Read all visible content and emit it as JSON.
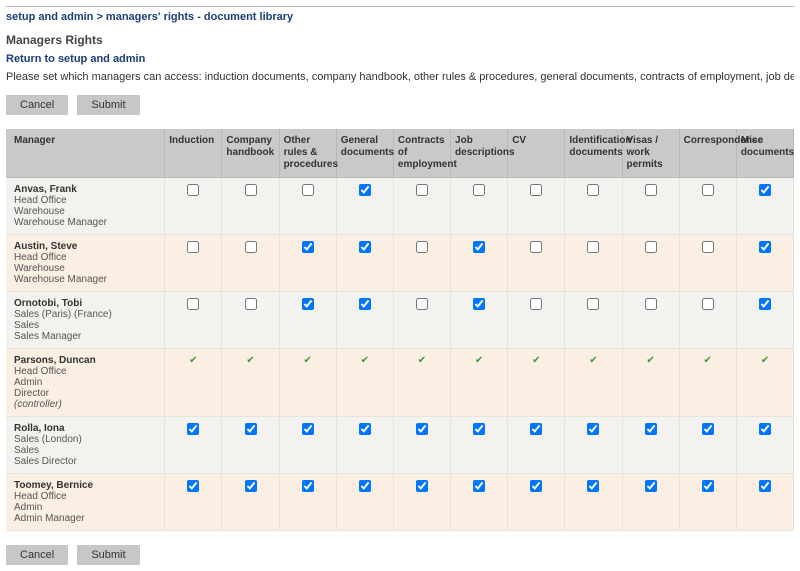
{
  "breadcrumb": "setup and admin > managers' rights - document library",
  "page_title": "Managers Rights",
  "return_link": "Return to setup and admin",
  "intro_text": "Please set which managers can access: induction documents, company handbook, other rules & procedures, general documents, contracts of employment, job descriptions, CVs, appraisals, correspondence...",
  "buttons": {
    "cancel": "Cancel",
    "submit": "Submit"
  },
  "columns": [
    "Manager",
    "Induction",
    "Company handbook",
    "Other rules & procedures",
    "General documents",
    "Contracts of employment",
    "Job descriptions",
    "CV",
    "Identification documents",
    "Visas / work permits",
    "Correspondence",
    "Misc documents"
  ],
  "rows": [
    {
      "name": "Anvas, Frank",
      "lines": [
        "Head Office",
        "Warehouse",
        "Warehouse Manager"
      ],
      "locked": false,
      "values": [
        false,
        false,
        false,
        true,
        false,
        false,
        false,
        false,
        false,
        false,
        true
      ]
    },
    {
      "name": "Austin, Steve",
      "lines": [
        "Head Office",
        "Warehouse",
        "Warehouse Manager"
      ],
      "locked": false,
      "values": [
        false,
        false,
        true,
        true,
        false,
        true,
        false,
        false,
        false,
        false,
        true
      ]
    },
    {
      "name": "Ornotobi, Tobi",
      "lines": [
        "Sales (Paris) (France)",
        "Sales",
        "Sales Manager"
      ],
      "locked": false,
      "values": [
        false,
        false,
        true,
        true,
        false,
        true,
        false,
        false,
        false,
        false,
        true
      ]
    },
    {
      "name": "Parsons, Duncan",
      "lines": [
        "Head Office",
        "Admin",
        "Director",
        "(controller)"
      ],
      "italic_last": true,
      "locked": true,
      "values": [
        true,
        true,
        true,
        true,
        true,
        true,
        true,
        true,
        true,
        true,
        true
      ]
    },
    {
      "name": "Rolla, Iona",
      "lines": [
        "Sales (London)",
        "Sales",
        "Sales Director"
      ],
      "locked": false,
      "values": [
        true,
        true,
        true,
        true,
        true,
        true,
        true,
        true,
        true,
        true,
        true
      ]
    },
    {
      "name": "Toomey, Bernice",
      "lines": [
        "Head Office",
        "Admin",
        "Admin Manager"
      ],
      "locked": false,
      "values": [
        true,
        true,
        true,
        true,
        true,
        true,
        true,
        true,
        true,
        true,
        true
      ]
    }
  ]
}
